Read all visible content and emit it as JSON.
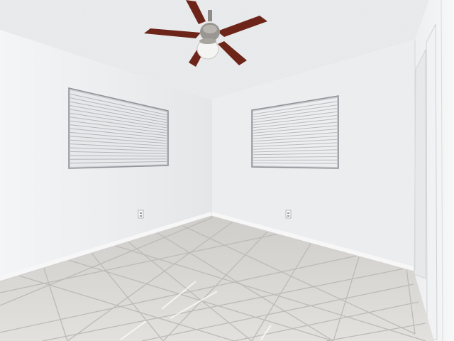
{
  "palette": {
    "ceiling": "#eceef0",
    "left_wall": "#f0f1f2",
    "back_wall": "#ecedee",
    "right_wall": "#f3f4f5",
    "floor_tile": "#dedddb",
    "grout": "#bdbbb8",
    "fan_blade": "#6e2519",
    "fan_metal": "#9a9792",
    "blind": "#e6e8ea",
    "baseboard": "#f7f7f7"
  }
}
